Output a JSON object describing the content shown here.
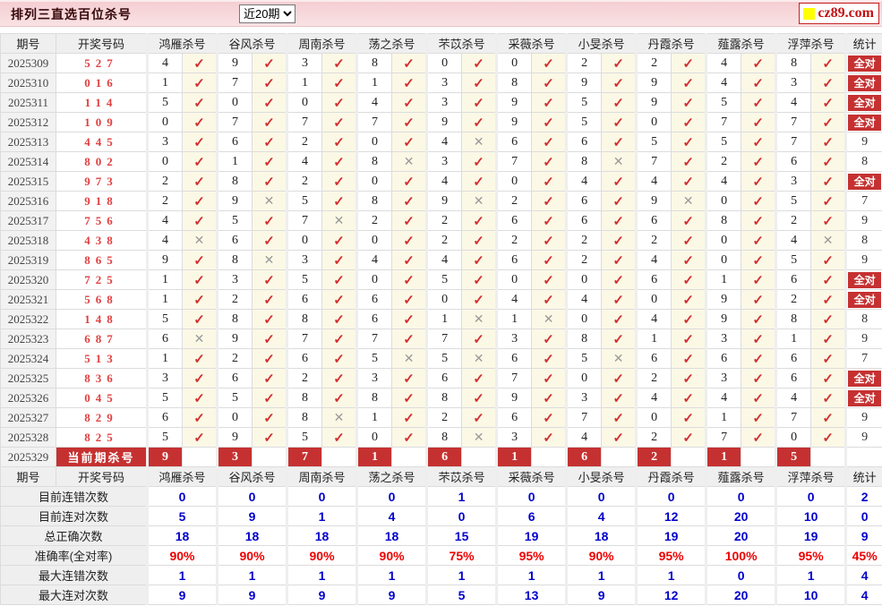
{
  "title": "排列三直选百位杀号",
  "range_select": {
    "value": "近20期"
  },
  "logo": {
    "text": "cz89.com"
  },
  "marks": {
    "correct": "✓",
    "wrong": "✕"
  },
  "all_correct_label": "全对",
  "columns": [
    "期号",
    "开奖号码",
    "鸿雁杀号",
    "谷风杀号",
    "周南杀号",
    "荡之杀号",
    "芣苡杀号",
    "采薇杀号",
    "小旻杀号",
    "丹霞杀号",
    "薤露杀号",
    "浮萍杀号",
    "统计"
  ],
  "rows": [
    {
      "period": "2025309",
      "draw": "527",
      "kills": [
        [
          4,
          1
        ],
        [
          9,
          1
        ],
        [
          3,
          1
        ],
        [
          8,
          1
        ],
        [
          0,
          1
        ],
        [
          0,
          1
        ],
        [
          2,
          1
        ],
        [
          2,
          1
        ],
        [
          4,
          1
        ],
        [
          8,
          1
        ]
      ],
      "stat": "全对"
    },
    {
      "period": "2025310",
      "draw": "016",
      "kills": [
        [
          1,
          1
        ],
        [
          7,
          1
        ],
        [
          1,
          1
        ],
        [
          1,
          1
        ],
        [
          3,
          1
        ],
        [
          8,
          1
        ],
        [
          9,
          1
        ],
        [
          9,
          1
        ],
        [
          4,
          1
        ],
        [
          3,
          1
        ]
      ],
      "stat": "全对"
    },
    {
      "period": "2025311",
      "draw": "114",
      "kills": [
        [
          5,
          1
        ],
        [
          0,
          1
        ],
        [
          0,
          1
        ],
        [
          4,
          1
        ],
        [
          3,
          1
        ],
        [
          9,
          1
        ],
        [
          5,
          1
        ],
        [
          9,
          1
        ],
        [
          5,
          1
        ],
        [
          4,
          1
        ]
      ],
      "stat": "全对"
    },
    {
      "period": "2025312",
      "draw": "109",
      "kills": [
        [
          0,
          1
        ],
        [
          7,
          1
        ],
        [
          7,
          1
        ],
        [
          7,
          1
        ],
        [
          9,
          1
        ],
        [
          9,
          1
        ],
        [
          5,
          1
        ],
        [
          0,
          1
        ],
        [
          7,
          1
        ],
        [
          7,
          1
        ]
      ],
      "stat": "全对"
    },
    {
      "period": "2025313",
      "draw": "445",
      "kills": [
        [
          3,
          1
        ],
        [
          6,
          1
        ],
        [
          2,
          1
        ],
        [
          0,
          1
        ],
        [
          4,
          0
        ],
        [
          6,
          1
        ],
        [
          6,
          1
        ],
        [
          5,
          1
        ],
        [
          5,
          1
        ],
        [
          7,
          1
        ]
      ],
      "stat": "9"
    },
    {
      "period": "2025314",
      "draw": "802",
      "kills": [
        [
          0,
          1
        ],
        [
          1,
          1
        ],
        [
          4,
          1
        ],
        [
          8,
          0
        ],
        [
          3,
          1
        ],
        [
          7,
          1
        ],
        [
          8,
          0
        ],
        [
          7,
          1
        ],
        [
          2,
          1
        ],
        [
          6,
          1
        ]
      ],
      "stat": "8"
    },
    {
      "period": "2025315",
      "draw": "973",
      "kills": [
        [
          2,
          1
        ],
        [
          8,
          1
        ],
        [
          2,
          1
        ],
        [
          0,
          1
        ],
        [
          4,
          1
        ],
        [
          0,
          1
        ],
        [
          4,
          1
        ],
        [
          4,
          1
        ],
        [
          4,
          1
        ],
        [
          3,
          1
        ]
      ],
      "stat": "全对"
    },
    {
      "period": "2025316",
      "draw": "918",
      "kills": [
        [
          2,
          1
        ],
        [
          9,
          0
        ],
        [
          5,
          1
        ],
        [
          8,
          1
        ],
        [
          9,
          0
        ],
        [
          2,
          1
        ],
        [
          6,
          1
        ],
        [
          9,
          0
        ],
        [
          0,
          1
        ],
        [
          5,
          1
        ]
      ],
      "stat": "7"
    },
    {
      "period": "2025317",
      "draw": "756",
      "kills": [
        [
          4,
          1
        ],
        [
          5,
          1
        ],
        [
          7,
          0
        ],
        [
          2,
          1
        ],
        [
          2,
          1
        ],
        [
          6,
          1
        ],
        [
          6,
          1
        ],
        [
          6,
          1
        ],
        [
          8,
          1
        ],
        [
          2,
          1
        ]
      ],
      "stat": "9"
    },
    {
      "period": "2025318",
      "draw": "438",
      "kills": [
        [
          4,
          0
        ],
        [
          6,
          1
        ],
        [
          0,
          1
        ],
        [
          0,
          1
        ],
        [
          2,
          1
        ],
        [
          2,
          1
        ],
        [
          2,
          1
        ],
        [
          2,
          1
        ],
        [
          0,
          1
        ],
        [
          4,
          0
        ]
      ],
      "stat": "8"
    },
    {
      "period": "2025319",
      "draw": "865",
      "kills": [
        [
          9,
          1
        ],
        [
          8,
          0
        ],
        [
          3,
          1
        ],
        [
          4,
          1
        ],
        [
          4,
          1
        ],
        [
          6,
          1
        ],
        [
          2,
          1
        ],
        [
          4,
          1
        ],
        [
          0,
          1
        ],
        [
          5,
          1
        ]
      ],
      "stat": "9"
    },
    {
      "period": "2025320",
      "draw": "725",
      "kills": [
        [
          1,
          1
        ],
        [
          3,
          1
        ],
        [
          5,
          1
        ],
        [
          0,
          1
        ],
        [
          5,
          1
        ],
        [
          0,
          1
        ],
        [
          0,
          1
        ],
        [
          6,
          1
        ],
        [
          1,
          1
        ],
        [
          6,
          1
        ]
      ],
      "stat": "全对"
    },
    {
      "period": "2025321",
      "draw": "568",
      "kills": [
        [
          1,
          1
        ],
        [
          2,
          1
        ],
        [
          6,
          1
        ],
        [
          6,
          1
        ],
        [
          0,
          1
        ],
        [
          4,
          1
        ],
        [
          4,
          1
        ],
        [
          0,
          1
        ],
        [
          9,
          1
        ],
        [
          2,
          1
        ]
      ],
      "stat": "全对"
    },
    {
      "period": "2025322",
      "draw": "148",
      "kills": [
        [
          5,
          1
        ],
        [
          8,
          1
        ],
        [
          8,
          1
        ],
        [
          6,
          1
        ],
        [
          1,
          0
        ],
        [
          1,
          0
        ],
        [
          0,
          1
        ],
        [
          4,
          1
        ],
        [
          9,
          1
        ],
        [
          8,
          1
        ]
      ],
      "stat": "8"
    },
    {
      "period": "2025323",
      "draw": "687",
      "kills": [
        [
          6,
          0
        ],
        [
          9,
          1
        ],
        [
          7,
          1
        ],
        [
          7,
          1
        ],
        [
          7,
          1
        ],
        [
          3,
          1
        ],
        [
          8,
          1
        ],
        [
          1,
          1
        ],
        [
          3,
          1
        ],
        [
          1,
          1
        ]
      ],
      "stat": "9"
    },
    {
      "period": "2025324",
      "draw": "513",
      "kills": [
        [
          1,
          1
        ],
        [
          2,
          1
        ],
        [
          6,
          1
        ],
        [
          5,
          0
        ],
        [
          5,
          0
        ],
        [
          6,
          1
        ],
        [
          5,
          0
        ],
        [
          6,
          1
        ],
        [
          6,
          1
        ],
        [
          6,
          1
        ]
      ],
      "stat": "7"
    },
    {
      "period": "2025325",
      "draw": "836",
      "kills": [
        [
          3,
          1
        ],
        [
          6,
          1
        ],
        [
          2,
          1
        ],
        [
          3,
          1
        ],
        [
          6,
          1
        ],
        [
          7,
          1
        ],
        [
          0,
          1
        ],
        [
          2,
          1
        ],
        [
          3,
          1
        ],
        [
          6,
          1
        ]
      ],
      "stat": "全对"
    },
    {
      "period": "2025326",
      "draw": "045",
      "kills": [
        [
          5,
          1
        ],
        [
          5,
          1
        ],
        [
          8,
          1
        ],
        [
          8,
          1
        ],
        [
          8,
          1
        ],
        [
          9,
          1
        ],
        [
          3,
          1
        ],
        [
          4,
          1
        ],
        [
          4,
          1
        ],
        [
          4,
          1
        ]
      ],
      "stat": "全对"
    },
    {
      "period": "2025327",
      "draw": "829",
      "kills": [
        [
          6,
          1
        ],
        [
          0,
          1
        ],
        [
          8,
          0
        ],
        [
          1,
          1
        ],
        [
          2,
          1
        ],
        [
          6,
          1
        ],
        [
          7,
          1
        ],
        [
          0,
          1
        ],
        [
          1,
          1
        ],
        [
          7,
          1
        ]
      ],
      "stat": "9"
    },
    {
      "period": "2025328",
      "draw": "825",
      "kills": [
        [
          5,
          1
        ],
        [
          9,
          1
        ],
        [
          5,
          1
        ],
        [
          0,
          1
        ],
        [
          8,
          0
        ],
        [
          3,
          1
        ],
        [
          4,
          1
        ],
        [
          2,
          1
        ],
        [
          7,
          1
        ],
        [
          0,
          1
        ]
      ],
      "stat": "9"
    }
  ],
  "current_row": {
    "period": "2025329",
    "label": "当前期杀号",
    "kills": [
      9,
      3,
      7,
      1,
      6,
      1,
      6,
      2,
      1,
      5
    ],
    "stat": ""
  },
  "stats_rows": [
    {
      "label": "目前连错次数",
      "values": [
        "0",
        "0",
        "0",
        "0",
        "1",
        "0",
        "0",
        "0",
        "0",
        "0"
      ],
      "total": "2",
      "accent": "blue"
    },
    {
      "label": "目前连对次数",
      "values": [
        "5",
        "9",
        "1",
        "4",
        "0",
        "6",
        "4",
        "12",
        "20",
        "10"
      ],
      "total": "0",
      "accent": "blue"
    },
    {
      "label": "总正确次数",
      "values": [
        "18",
        "18",
        "18",
        "18",
        "15",
        "19",
        "18",
        "19",
        "20",
        "19"
      ],
      "total": "9",
      "accent": "blue"
    },
    {
      "label": "准确率(全对率)",
      "values": [
        "90%",
        "90%",
        "90%",
        "90%",
        "75%",
        "95%",
        "90%",
        "95%",
        "100%",
        "95%"
      ],
      "total": "45%",
      "accent": "red"
    },
    {
      "label": "最大连错次数",
      "values": [
        "1",
        "1",
        "1",
        "1",
        "1",
        "1",
        "1",
        "1",
        "0",
        "1"
      ],
      "total": "4",
      "accent": "blue"
    },
    {
      "label": "最大连对次数",
      "values": [
        "9",
        "9",
        "9",
        "9",
        "5",
        "13",
        "9",
        "12",
        "20",
        "10"
      ],
      "total": "4",
      "accent": "blue"
    }
  ],
  "colors": {
    "accent_red": "#c53131",
    "check_red": "#d23030",
    "cross_gray": "#9a9a9a",
    "value_blue": "#0000cc",
    "rate_red": "#ee0000",
    "draw_red": "#e04040",
    "topbar_pink": "#f4ced2"
  }
}
